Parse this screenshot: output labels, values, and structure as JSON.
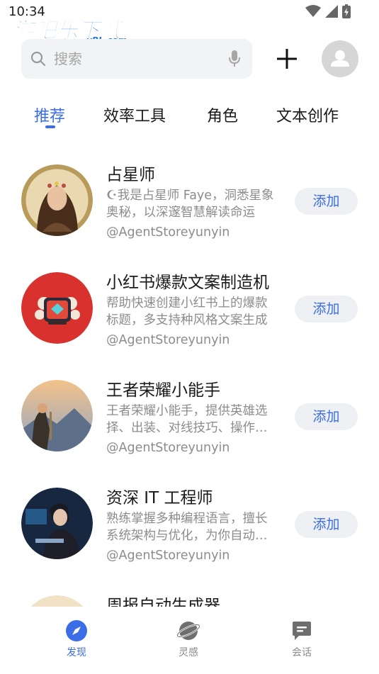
{
  "status_bar": {
    "time": "10:34"
  },
  "watermark": {
    "main": "游吧乐下载",
    "sub": "yBL.com"
  },
  "search": {
    "placeholder": "搜索"
  },
  "tabs": [
    {
      "label": "推荐",
      "active": true
    },
    {
      "label": "效率工具",
      "active": false
    },
    {
      "label": "角色",
      "active": false
    },
    {
      "label": "文本创作",
      "active": false
    }
  ],
  "agents": [
    {
      "name": "占星师",
      "description": "☪我是占星师 Faye，洞悉星象奥秘，以深邃智慧解读命运",
      "author": "@AgentStoreyunyin",
      "add_label": "添加",
      "avatar_icon": "astrologer-portrait"
    },
    {
      "name": "小红书爆款文案制造机",
      "description": "帮助快速创建小红书上的爆款标题，多支持种风格文案生成",
      "author": "@AgentStoreyunyin",
      "add_label": "添加",
      "avatar_icon": "red-camera-logo"
    },
    {
      "name": "王者荣耀小能手",
      "description": "王者荣耀小能手，提供英雄选择、出装、对线技巧、操作指导",
      "author": "@AgentStoreyunyin",
      "add_label": "添加",
      "avatar_icon": "warrior-landscape"
    },
    {
      "name": "资深 IT 工程师",
      "description": "熟练掌握多种编程语言，擅长系统架构与优化，为你自动解答",
      "author": "@AgentStoreyunyin",
      "add_label": "添加",
      "avatar_icon": "engineer-at-laptop"
    },
    {
      "name": "周报自动生成器",
      "description": "",
      "author": "",
      "add_label": "",
      "avatar_icon": "report-generator"
    }
  ],
  "bottom_nav": [
    {
      "label": "发现",
      "icon": "compass-icon",
      "active": true
    },
    {
      "label": "灵感",
      "icon": "planet-icon",
      "active": false
    },
    {
      "label": "会话",
      "icon": "chat-icon",
      "active": false
    }
  ],
  "colors": {
    "accent": "#3b6ee6",
    "muted_text": "#8c8c8c",
    "search_bg": "#f2f3f5",
    "button_bg": "#eef0f3"
  }
}
